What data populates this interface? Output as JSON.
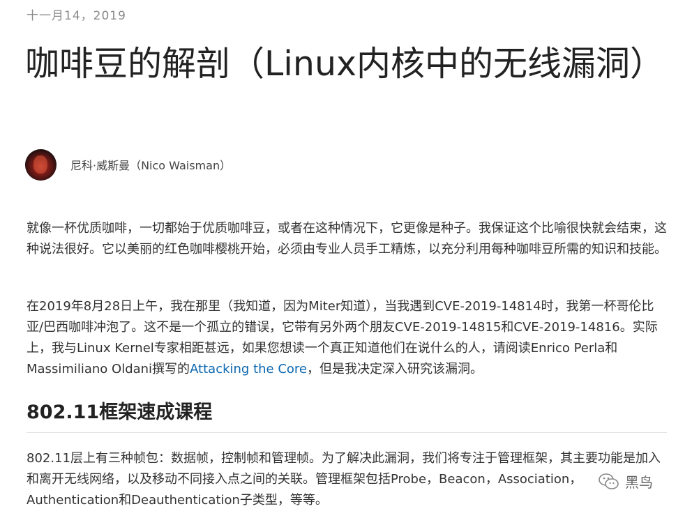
{
  "post": {
    "date": "十一月14，2019",
    "title": "咖啡豆的解剖（Linux内核中的无线漏洞）",
    "author": "尼科·威斯曼（Nico Waisman）"
  },
  "paragraph1": "就像一杯优质咖啡，一切都始于优质咖啡豆，或者在这种情况下，它更像是种子。我保证这个比喻很快就会结束，这种说法很好。它以美丽的红色咖啡樱桃开始，必须由专业人员手工精炼，以充分利用每种咖啡豆所需的知识和技能。",
  "paragraph2": {
    "before": "在2019年8月28日上午，我在那里（我知道，因为Miter知道），当我遇到CVE-2019-14814时，我第一杯哥伦比亚/巴西咖啡冲泡了。这不是一个孤立的错误，它带有另外两个朋友CVE-2019-14815和CVE-2019-14816。实际上，我与Linux Kernel专家相距甚远，如果您想读一个真正知道他们在说什么的人，请阅读Enrico Perla和Massimiliano Oldani撰写的",
    "link": "Attacking the Core",
    "after": "，但是我决定深入研究该漏洞。"
  },
  "section": {
    "heading": "802.11框架速成课程",
    "paragraph": "802.11层上有三种帧包：数据帧，控制帧和管理帧。为了解决此漏洞，我们将专注于管理框架，其主要功能是加入和离开无线网络，以及移动不同接入点之间的关联。管理框架包括Probe，Beacon，Association，Authentication和Deauthentication子类型，等等。"
  },
  "watermark": {
    "label": "黑鸟",
    "icon": "wechat-icon"
  }
}
